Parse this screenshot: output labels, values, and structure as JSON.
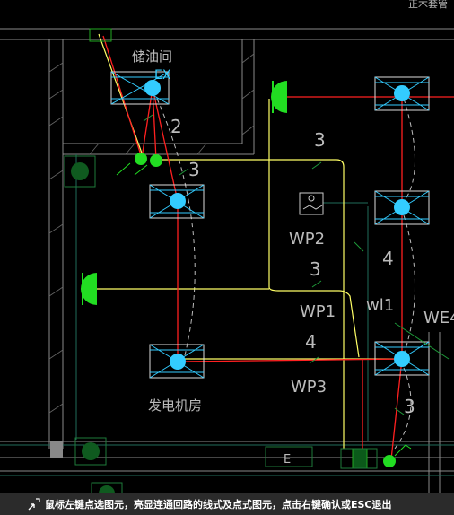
{
  "drawing": {
    "room_labels": {
      "fuel_room": "储油间",
      "generator_room": "发电机房",
      "top_right_fragment": "正木套管"
    },
    "circuit_labels": {
      "wp1": "WP1",
      "wp2": "WP2",
      "wp3": "WP3",
      "we4": "WE4",
      "wl1": "wl1",
      "ex": "EX",
      "e_box": "E"
    },
    "wire_counts": {
      "n2": "2",
      "n3_left": "3",
      "n3_top": "3",
      "n3_mid": "3",
      "n4_right": "4",
      "n4_mid": "4",
      "n3_bottom": "3"
    },
    "colors": {
      "background": "#000000",
      "highlight_line": "#ff2020",
      "yellow_line": "#ffff66",
      "cyan_fixture": "#33ccff",
      "green_symbol": "#22dd22",
      "wall": "#9a9a9a"
    }
  },
  "status_bar": {
    "icon": "cursor-select-icon",
    "message": "鼠标左键点选图元，亮显连通回路的线式及点式图元，点击右键确认或ESC退出"
  }
}
